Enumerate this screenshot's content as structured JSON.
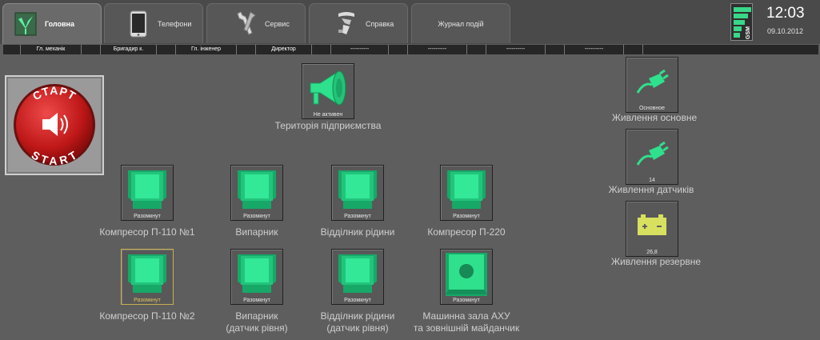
{
  "tabs": [
    {
      "label": "Головна",
      "icon": "home-leaf-icon"
    },
    {
      "label": "Телефони",
      "icon": "phone-icon"
    },
    {
      "label": "Сервис",
      "icon": "tools-icon"
    },
    {
      "label": "Справка",
      "icon": "help-icon"
    },
    {
      "label": "Журнал подій",
      "icon": ""
    }
  ],
  "clock": {
    "time": "12:03",
    "date": "09.10.2012"
  },
  "gsm": {
    "label": "GSM",
    "signal_bars": 5
  },
  "contacts": [
    "Гл. механік",
    "Бригадир к.",
    "Гл. інженер",
    "Директор",
    "----------",
    "----------",
    "----------",
    "----------"
  ],
  "start_button": {
    "line1": "СТАРТ",
    "line2": "START"
  },
  "siren": {
    "status": "Не активен",
    "caption": "Територія підприємства"
  },
  "sensors": [
    {
      "status": "Разомкнут",
      "caption": "Компресор П-110 №1"
    },
    {
      "status": "Разомкнут",
      "caption": "Випарник"
    },
    {
      "status": "Разомкнут",
      "caption": "Відділник рідини"
    },
    {
      "status": "Разомкнут",
      "caption": "Компресор П-220"
    },
    {
      "status": "Разомкнут",
      "caption": "Компресор П-110 №2"
    },
    {
      "status": "Разомкнут",
      "caption_line1": "Випарник",
      "caption_line2": "(датчик рівня)"
    },
    {
      "status": "Разомкнут",
      "caption_line1": "Відділник рідини",
      "caption_line2": "(датчик рівня)"
    },
    {
      "status": "Разомкнут",
      "caption_line1": "Машинна зала АХУ",
      "caption_line2": "та зовнішній майданчик"
    }
  ],
  "power": [
    {
      "status": "Основное",
      "caption": "Живлення основне",
      "icon": "power-plug-icon"
    },
    {
      "status": "14",
      "caption": "Живлення датчиків",
      "icon": "power-plug-icon"
    },
    {
      "status": "26,8",
      "caption": "Живлення резервне",
      "icon": "battery-icon"
    }
  ],
  "colors": {
    "accent_green": "#2fe08c",
    "background": "#5e5e5e",
    "start_red": "#c81e1e",
    "battery_yellow": "#d8e060"
  }
}
